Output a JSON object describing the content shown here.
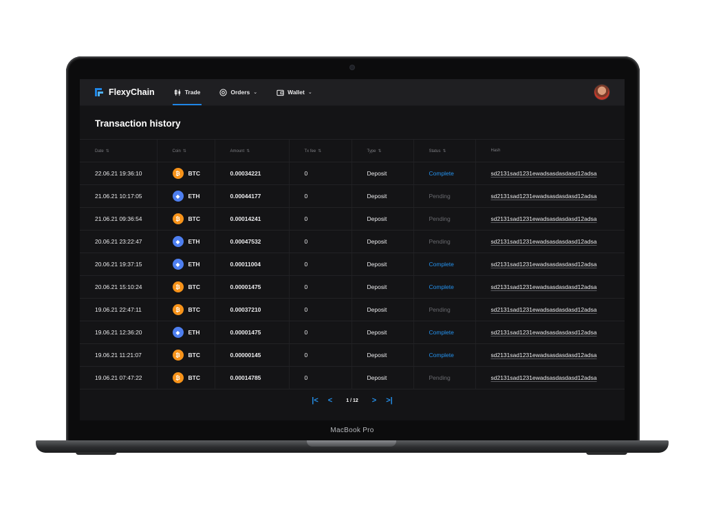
{
  "device": {
    "label": "MacBook Pro"
  },
  "app": {
    "brand": "FlexyChain",
    "nav": [
      {
        "label": "Trade",
        "icon": "candlestick-icon",
        "active": true
      },
      {
        "label": "Orders",
        "icon": "target-circle-icon",
        "dropdown": true
      },
      {
        "label": "Wallet",
        "icon": "wallet-icon",
        "dropdown": true
      }
    ],
    "accent": "#1f86e6"
  },
  "page": {
    "title": "Transaction history"
  },
  "table": {
    "columns": [
      {
        "label": "Date",
        "sort": "⇅"
      },
      {
        "label": "Coin",
        "sort": "⇅"
      },
      {
        "label": "Amount",
        "sort": "⇅"
      },
      {
        "label": "Tx fee",
        "sort": "⇅"
      },
      {
        "label": "Type",
        "sort": "⇅"
      },
      {
        "label": "Status",
        "sort": "⇅"
      },
      {
        "label": "Hash",
        "sort": ""
      }
    ],
    "rows": [
      {
        "date": "22.06.21 19:36:10",
        "coin": "BTC",
        "amount": "0.00034221",
        "fee": "0",
        "type": "Deposit",
        "status": "Complete",
        "hash": "sd2131sad1231ewadsasdasdasd12adsa"
      },
      {
        "date": "21.06.21 10:17:05",
        "coin": "ETH",
        "amount": "0.00044177",
        "fee": "0",
        "type": "Deposit",
        "status": "Pending",
        "hash": "sd2131sad1231ewadsasdasdasd12adsa"
      },
      {
        "date": "21.06.21 09:36:54",
        "coin": "BTC",
        "amount": "0.00014241",
        "fee": "0",
        "type": "Deposit",
        "status": "Pending",
        "hash": "sd2131sad1231ewadsasdasdasd12adsa"
      },
      {
        "date": "20.06.21 23:22:47",
        "coin": "ETH",
        "amount": "0.00047532",
        "fee": "0",
        "type": "Deposit",
        "status": "Pending",
        "hash": "sd2131sad1231ewadsasdasdasd12adsa"
      },
      {
        "date": "20.06.21 19:37:15",
        "coin": "ETH",
        "amount": "0.00011004",
        "fee": "0",
        "type": "Deposit",
        "status": "Complete",
        "hash": "sd2131sad1231ewadsasdasdasd12adsa"
      },
      {
        "date": "20.06.21 15:10:24",
        "coin": "BTC",
        "amount": "0.00001475",
        "fee": "0",
        "type": "Deposit",
        "status": "Complete",
        "hash": "sd2131sad1231ewadsasdasdasd12adsa"
      },
      {
        "date": "19.06.21 22:47:11",
        "coin": "BTC",
        "amount": "0.00037210",
        "fee": "0",
        "type": "Deposit",
        "status": "Pending",
        "hash": "sd2131sad1231ewadsasdasdasd12adsa"
      },
      {
        "date": "19.06.21 12:36:20",
        "coin": "ETH",
        "amount": "0.00001475",
        "fee": "0",
        "type": "Deposit",
        "status": "Complete",
        "hash": "sd2131sad1231ewadsasdasdasd12adsa"
      },
      {
        "date": "19.06.21 11:21:07",
        "coin": "BTC",
        "amount": "0.00000145",
        "fee": "0",
        "type": "Deposit",
        "status": "Complete",
        "hash": "sd2131sad1231ewadsasdasdasd12adsa"
      },
      {
        "date": "19.06.21 07:47:22",
        "coin": "BTC",
        "amount": "0.00014785",
        "fee": "0",
        "type": "Deposit",
        "status": "Pending",
        "hash": "sd2131sad1231ewadsasdasdasd12adsa"
      }
    ]
  },
  "pagination": {
    "first": "|<",
    "prev": "<",
    "info": "1 / 12",
    "next": ">",
    "last": ">|"
  },
  "colors": {
    "btc": "#f7931a",
    "eth": "#4e7ff0",
    "complete": "#2593f0",
    "pending": "#6a6b70"
  }
}
